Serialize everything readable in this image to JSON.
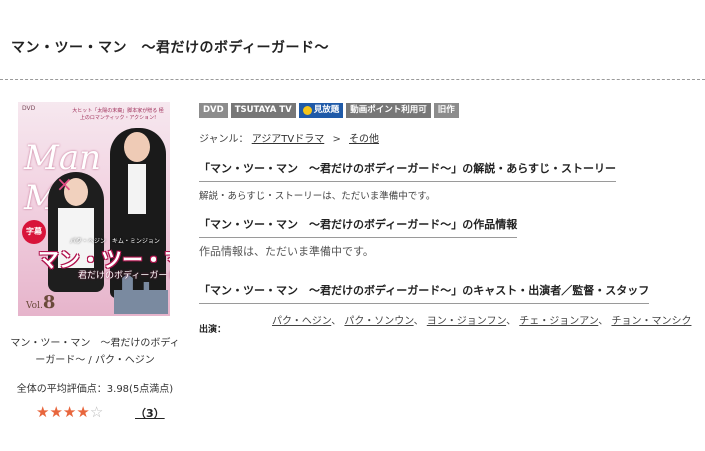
{
  "page": {
    "title": "マン・ツー・マン　～君だけのボディーガード～"
  },
  "cover": {
    "dvd_tag": "DVD",
    "blurb": "大ヒット「太陽の末裔」脚本家が贈る 極上のロマンティック・アクション!",
    "script_title": "Man Man",
    "times_glyph": "×",
    "badge": "字幕",
    "cast": "パク・ヘジン　キム・ミンジョン",
    "jp_title": "マン・ツー・マン",
    "sub_title": "君だけのボディーガード",
    "vol_label": "Vol.",
    "vol_number": "8"
  },
  "product": {
    "name": "マン・ツー・マン　～君だけのボディーガード～ / パク・ヘジン",
    "rating_text": "全体の平均評価点：3.98(5点満点)",
    "rating_value": 3.98,
    "stars_filled": 4,
    "stars_total": 5,
    "review_count": "（3）"
  },
  "tags": [
    "DVD",
    "TSUTAYA TV",
    "見放題",
    "動画ポイント利用可",
    "旧作"
  ],
  "genre": {
    "label": "ジャンル：",
    "items": [
      "アジアTVドラマ",
      "その他"
    ],
    "separator": ">"
  },
  "sections": {
    "story_heading": "「マン・ツー・マン　～君だけのボディーガード～」の解説・あらすじ・ストーリー",
    "story_body": "解説・あらすじ・ストーリーは、ただいま準備中です。",
    "info_heading": "「マン・ツー・マン　～君だけのボディーガード～」の作品情報",
    "info_body": "作品情報は、ただいま準備中です。",
    "cast_heading": "「マン・ツー・マン　～君だけのボディーガード～」のキャスト・出演者／監督・スタッフ"
  },
  "cast": {
    "label": "出演：",
    "names": [
      "パク・ヘジン",
      "パク・ソンウン",
      "ヨン・ジョンフン",
      "チェ・ジョンアン",
      "チョン・マンシク"
    ],
    "delimiter": "、"
  },
  "colors": {
    "star_on": "#e8663d",
    "star_off": "#bbbbbb",
    "tag_gray": "#8c8c8c",
    "tag_blue": "#1f5aa8",
    "cover_pink": "#f2d2e1"
  }
}
